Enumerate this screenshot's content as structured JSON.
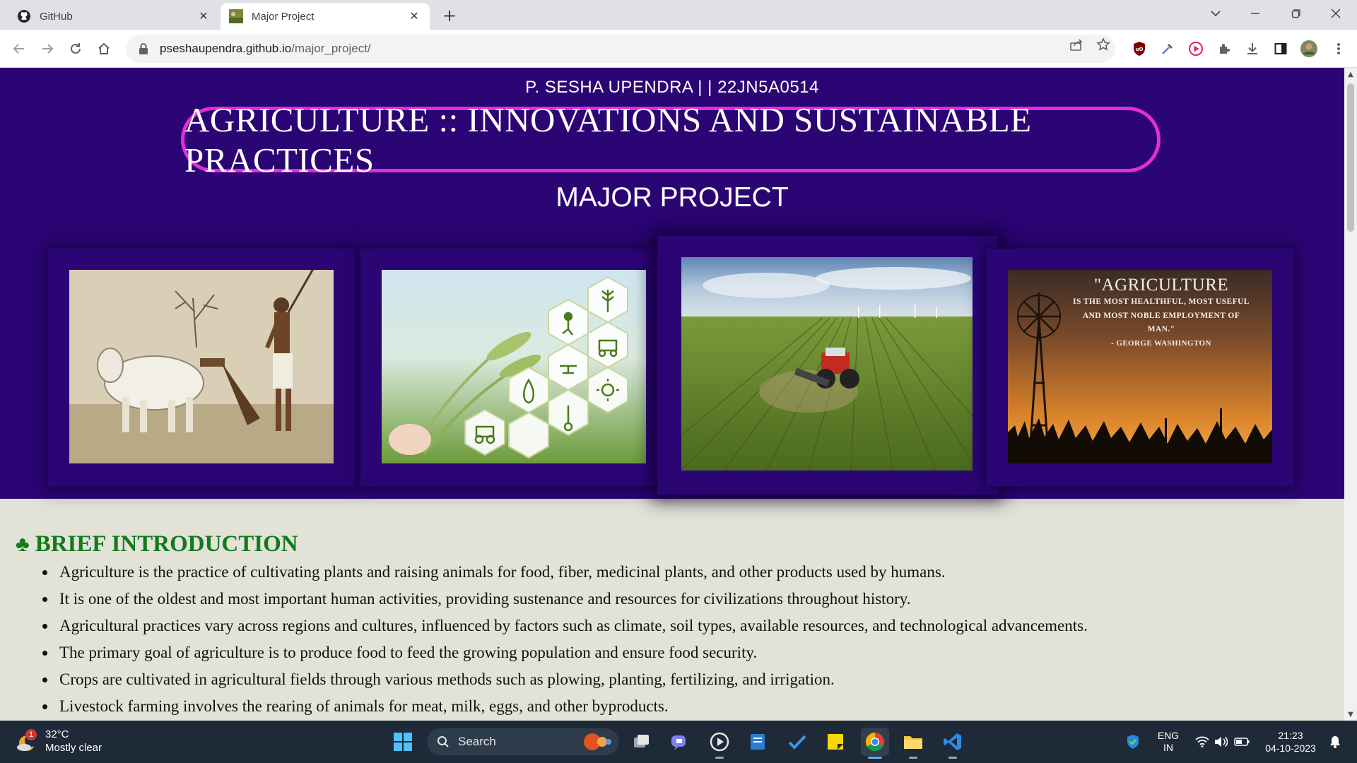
{
  "browser": {
    "tabs": [
      {
        "title": "GitHub",
        "favicon": "github-icon",
        "active": false
      },
      {
        "title": "Major Project",
        "favicon": "agriculture-thumbnail",
        "active": true
      }
    ],
    "url_host": "pseshaupendra.github.io",
    "url_path": "/major_project/"
  },
  "page": {
    "author": "P. SESHA UPENDRA | | 22JN5A0514",
    "title": "AGRICULTURE :: INNOVATIONS AND SUSTAINABLE PRACTICES",
    "subtitle": "MAJOR PROJECT",
    "gallery": [
      {
        "alt": "plowing-with-oxen-painting"
      },
      {
        "alt": "smart-farming-wheat-hexagon-icons"
      },
      {
        "alt": "tractor-on-green-field"
      },
      {
        "alt": "sunset-windmill-quote",
        "quote_head": "\"AGRICULTURE",
        "quote_l1": "IS THE MOST HEALTHFUL, MOST USEFUL",
        "quote_l2": "AND MOST NOBLE EMPLOYMENT OF",
        "quote_l3": "MAN.\"",
        "quote_attr": "- GEORGE WASHINGTON"
      }
    ],
    "intro": {
      "heading": "BRIEF INTRODUCTION",
      "items": [
        "Agriculture is the practice of cultivating plants and raising animals for food, fiber, medicinal plants, and other products used by humans.",
        "It is one of the oldest and most important human activities, providing sustenance and resources for civilizations throughout history.",
        "Agricultural practices vary across regions and cultures, influenced by factors such as climate, soil types, available resources, and technological advancements.",
        "The primary goal of agriculture is to produce food to feed the growing population and ensure food security.",
        "Crops are cultivated in agricultural fields through various methods such as plowing, planting, fertilizing, and irrigation.",
        "Livestock farming involves the rearing of animals for meat, milk, eggs, and other byproducts."
      ]
    }
  },
  "taskbar": {
    "weather_temp": "32°C",
    "weather_desc": "Mostly clear",
    "weather_badge": "1",
    "search_label": "Search",
    "lang_1": "ENG",
    "lang_2": "IN",
    "time": "21:23",
    "date": "04-10-2023"
  },
  "colors": {
    "hero_bg": "#2c0575",
    "title_border": "#e02fd9",
    "heading_green": "#117a1c",
    "page_bg": "#e3e2d6"
  }
}
